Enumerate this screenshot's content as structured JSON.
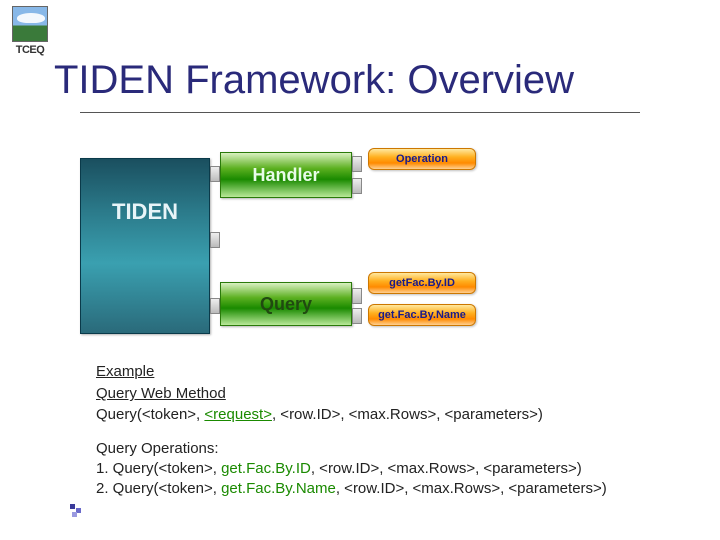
{
  "logo": {
    "text": "TCEQ"
  },
  "title": "TIDEN Framework: Overview",
  "diagram": {
    "tiden": "TIDEN",
    "handler": "Handler",
    "query": "Query",
    "operation": "Operation",
    "getFacById": "getFac.By.ID",
    "getFacByName": "get.Fac.By.Name"
  },
  "example": {
    "header": "Example",
    "webMethodLabel": "Query Web Method",
    "queryLine_prefix": "Query(<token>, ",
    "queryLine_request": "<request>",
    "queryLine_suffix": ", <row.ID>, <max.Rows>, <parameters>)",
    "opsHeader": "Query Operations:",
    "op1_prefix": "1. Query(<token>, ",
    "op1_name": "get.Fac.By.ID",
    "op1_suffix": ", <row.ID>, <max.Rows>, <parameters>)",
    "op2_prefix": " 2. Query(<token>, ",
    "op2_name": "get.Fac.By.Name",
    "op2_suffix": ", <row.ID>, <max.Rows>, <parameters>)"
  }
}
